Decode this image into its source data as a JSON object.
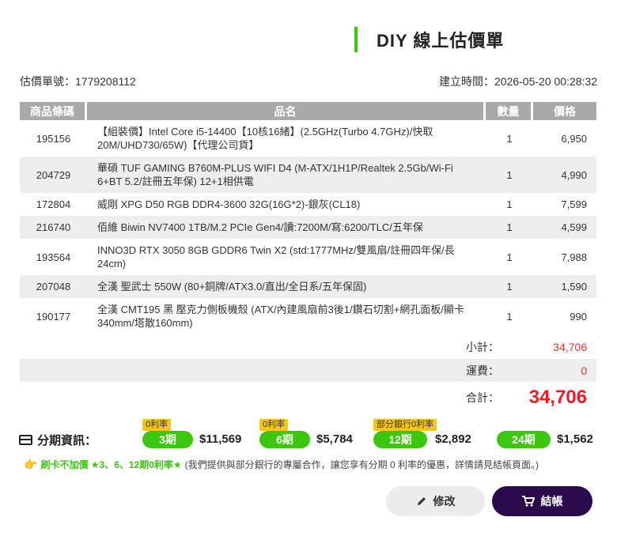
{
  "header": {
    "title": "DIY 線上估價單"
  },
  "meta": {
    "quote_no": "估價單號：1779208112",
    "created": "建立時間：2026-05-20 00:28:32"
  },
  "table": {
    "headers": [
      "商品條碼",
      "品名",
      "數量",
      "價格"
    ],
    "rows": [
      {
        "code": "195156",
        "name": "【組裝價】Intel Core i5-14400【10核16緒】(2.5GHz(Turbo 4.7GHz)/快取20M/UHD730/65W)【代理公司貨】",
        "qty": "1",
        "price": "6,950"
      },
      {
        "code": "204729",
        "name": "華碩 TUF GAMING B760M-PLUS WIFI D4 (M-ATX/1H1P/Realtek 2.5Gb/Wi-Fi 6+BT 5.2/註冊五年保) 12+1相供電",
        "qty": "1",
        "price": "4,990"
      },
      {
        "code": "172804",
        "name": "威剛 XPG D50 RGB DDR4-3600 32G(16G*2)-銀灰(CL18)",
        "qty": "1",
        "price": "7,599"
      },
      {
        "code": "216740",
        "name": "佰維 Biwin NV7400 1TB/M.2 PCIe Gen4/讀:7200M/寫:6200/TLC/五年保",
        "qty": "1",
        "price": "4,599"
      },
      {
        "code": "193564",
        "name": "INNO3D RTX 3050 8GB GDDR6 Twin X2 (std:1777MHz/雙風扇/註冊四年保/長24cm)",
        "qty": "1",
        "price": "7,988"
      },
      {
        "code": "207048",
        "name": "全漢 聖武士 550W (80+銅牌/ATX3.0/直出/全日系/五年保固)",
        "qty": "1",
        "price": "1,590"
      },
      {
        "code": "190177",
        "name": "全漢 CMT195 黑 壓克力側板機殼 (ATX/內建風扇前3後1/鑽石切割+網孔面板/顯卡340mm/塔散160mm)",
        "qty": "1",
        "price": "990"
      }
    ]
  },
  "summary": {
    "subtotal_label": "小計：",
    "subtotal": "34,706",
    "shipping_label": "運費：",
    "shipping": "0",
    "total_label": "合計：",
    "total": "34,706"
  },
  "installment": {
    "label": "分期資訊：",
    "plans": [
      {
        "tag": "0利率",
        "term": "3期",
        "amount": "$11,569"
      },
      {
        "tag": "0利率",
        "term": "6期",
        "amount": "$5,784"
      },
      {
        "tag": "部分銀行0利率",
        "term": "12期",
        "amount": "$2,892"
      },
      {
        "tag": "",
        "term": "24期",
        "amount": "$1,562"
      }
    ],
    "promo_hand": "👉",
    "promo_highlight": "刷卡不加價  ★3、6、12期0利率★",
    "promo_note": "(我們提供與部分銀行的專屬合作，讓您享有分期 0 利率的優惠，詳情請見結帳頁面。)"
  },
  "buttons": {
    "edit": "修改",
    "checkout": "結帳"
  },
  "colors": {
    "accent_green": "#3cc70f",
    "price_red": "#ee1c25",
    "tag_yellow": "#f5c518",
    "checkout_purple": "#2a0a4a"
  },
  "icons": {
    "edit": "pencil-icon",
    "checkout": "cart-icon",
    "installment": "credit-card-icon"
  }
}
